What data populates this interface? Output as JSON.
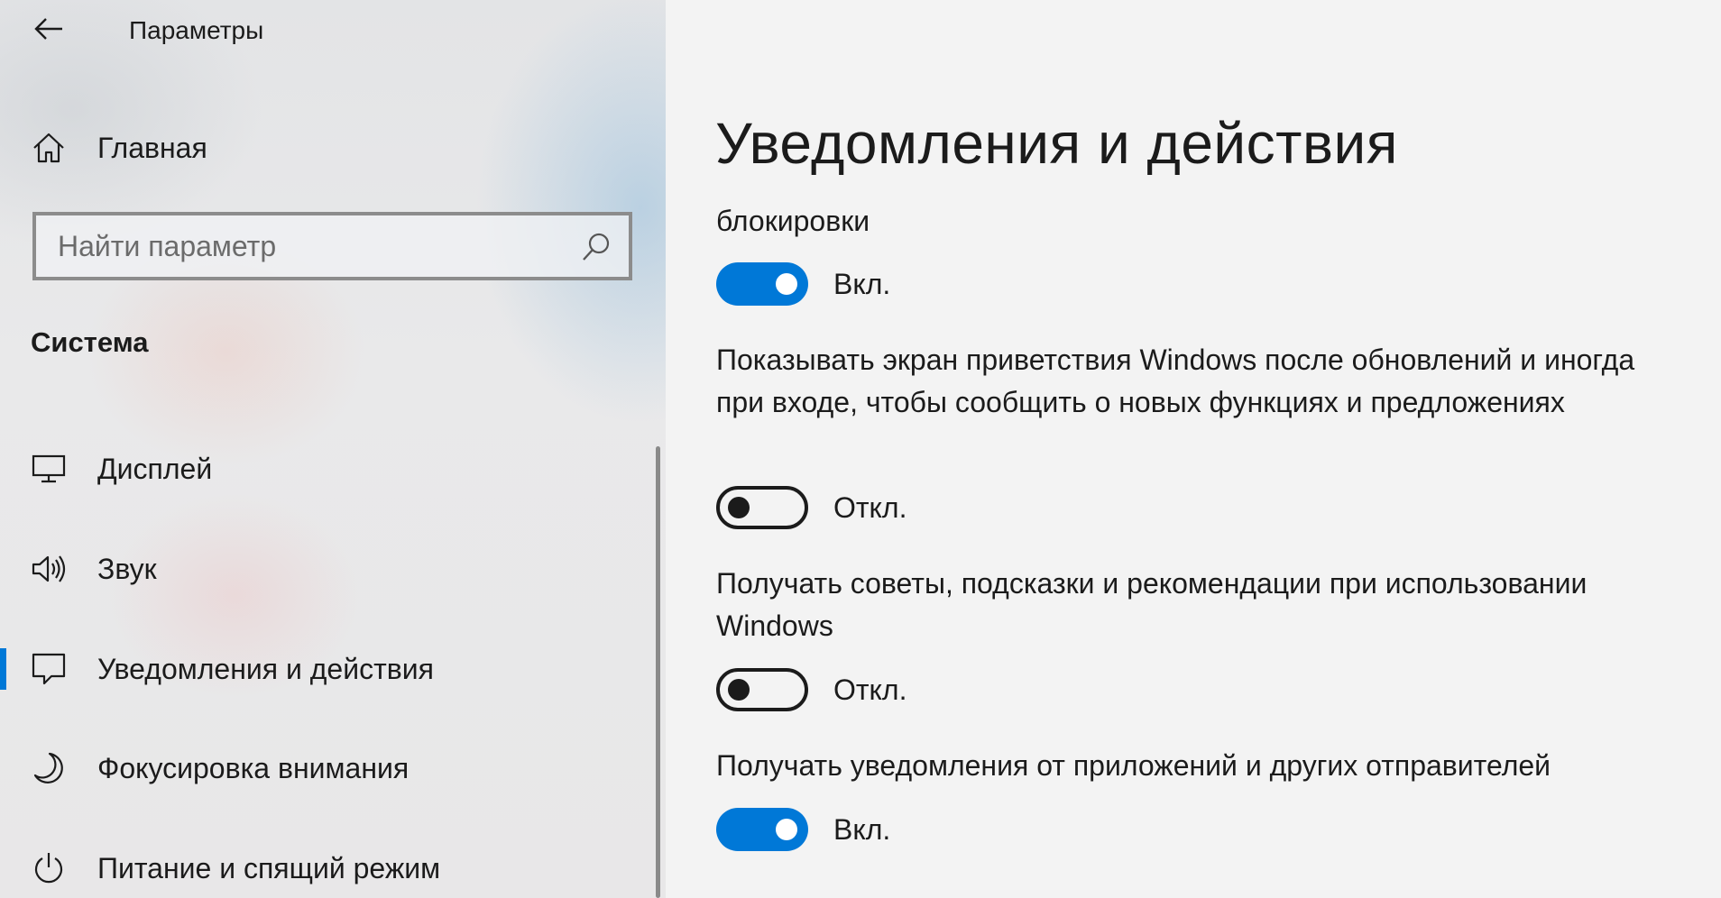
{
  "window": {
    "title": "Параметры"
  },
  "sidebar": {
    "home_label": "Главная",
    "search": {
      "placeholder": "Найти параметр"
    },
    "section_heading": "Система",
    "items": [
      {
        "label": "Дисплей",
        "icon": "display-icon",
        "selected": false
      },
      {
        "label": "Звук",
        "icon": "speaker-icon",
        "selected": false
      },
      {
        "label": "Уведомления и действия",
        "icon": "notification-icon",
        "selected": true
      },
      {
        "label": "Фокусировка внимания",
        "icon": "moon-icon",
        "selected": false
      },
      {
        "label": "Питание и спящий режим",
        "icon": "power-icon",
        "selected": false
      }
    ],
    "accent_color": "#0078d7"
  },
  "main": {
    "title": "Уведомления и действия",
    "settings": [
      {
        "text": "блокировки",
        "state": "Вкл.",
        "on": true
      },
      {
        "text": "Показывать экран приветствия Windows после обновлений и иногда при входе, чтобы сообщить о новых функциях и предложениях",
        "state": "Откл.",
        "on": false
      },
      {
        "text": "Получать советы, подсказки и рекомендации при использовании Windows",
        "state": "Откл.",
        "on": false
      },
      {
        "text": "Получать уведомления от приложений и других отправителей",
        "state": "Вкл.",
        "on": true
      }
    ]
  }
}
